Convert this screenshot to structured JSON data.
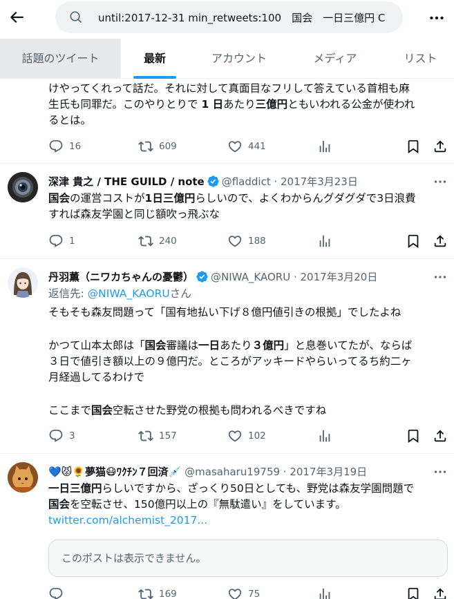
{
  "search": {
    "query": "until:2017-12-31 min_retweets:100　国会　一日三億円 C"
  },
  "tabs": [
    "話題のツイート",
    "最新",
    "アカウント",
    "メディア",
    "リスト"
  ],
  "tweets": [
    {
      "body_parts": [
        [
          "けやってくれって話だ。それに対して真面目なフリして答えている首相も麻",
          ""
        ],
        [
          "生氏も同罪だ。このやりとりで ",
          "1 日",
          "あたり",
          "三億円",
          "ともいわれる公金が使われ"
        ],
        [
          "るとは。",
          ""
        ]
      ],
      "replies": "16",
      "retweets": "609",
      "likes": "441"
    },
    {
      "name": "深津 貴之 / THE GUILD / note",
      "meta": "@fladdict · 2017年3月23日",
      "body": {
        "l1_b1": "国会",
        "l1_t1": "の運営コストが",
        "l1_b2": "1日三億円",
        "l1_t2": "らしいので、よくわからんグダグダで3日浪費",
        "l2": "すれば森友学園と同じ額吹っ飛ぶな"
      },
      "replies": "1",
      "retweets": "240",
      "likes": "188"
    },
    {
      "name": "丹羽薫（ニワカちゃんの憂鬱）",
      "meta": "@NIWA_KAORU · 2017年3月20日",
      "reply_prefix": "返信先: ",
      "reply_handle": "@NIWA_KAORU",
      "reply_suffix": "さん",
      "body": {
        "p1": "そもそも森友問題って「国有地払い下げ８億円値引きの根拠」でしたよね",
        "p2_t1": "かつて山本太郎は「",
        "p2_b1": "国会",
        "p2_t2": "審議は",
        "p2_b2": "一日",
        "p2_t3": "あたり",
        "p2_b3": "３億円",
        "p2_t4": "」と息巻いてたが、ならば",
        "p2_l2": "３日で値引き額以上の９億円だ。ところがアッキードやらいってるち約二ヶ",
        "p2_l3": "月経過してるわけで",
        "p3_t1": "ここまで",
        "p3_b1": "国会",
        "p3_t2": "空転させた野党の根拠も問われるべきですね"
      },
      "replies": "3",
      "retweets": "157",
      "likes": "102"
    },
    {
      "name_emoji_1": "💙😾🌻",
      "name": "夢猫",
      "name_emoji_2": "😷",
      "name_suffix": "ﾜｸﾁﾝ７回済",
      "name_emoji_3": "💉",
      "meta": "@masaharu19759 · 2017年3月19日",
      "body": {
        "l1_b1": "一日三億円",
        "l1_t1": "らしいですから、ざっくり50日としても、野党は森友学園問題で",
        "l2_b1": "国会",
        "l2_t1": "を空転させ、150億円以上の『無駄遣い』をしています。",
        "link": "twitter.com/alchemist_2017..."
      },
      "quote": "このポストは表示できません。",
      "replies": "",
      "retweets": "169",
      "likes": "75"
    }
  ]
}
